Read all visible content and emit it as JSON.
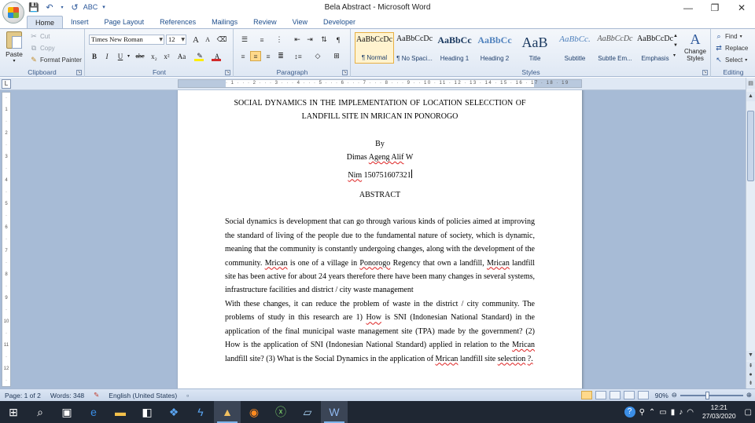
{
  "window": {
    "title": "Bela Abstract - Microsoft Word",
    "minimize": "—",
    "restore": "❐",
    "close": "✕"
  },
  "tabs": [
    "Home",
    "Insert",
    "Page Layout",
    "References",
    "Mailings",
    "Review",
    "View",
    "Developer"
  ],
  "ribbon": {
    "clipboard": {
      "label": "Clipboard",
      "paste": "Paste",
      "cut": "Cut",
      "copy": "Copy",
      "format_painter": "Format Painter"
    },
    "font": {
      "label": "Font",
      "font_name": "Times New Roman",
      "font_size": "12",
      "grow": "A",
      "shrink": "A",
      "bold": "B",
      "italic": "I",
      "underline": "U",
      "strike": "abc",
      "subscript": "x₂",
      "superscript": "x²",
      "change_case": "Aa",
      "highlight_color": "#ffee00",
      "font_color": "#d22a2a"
    },
    "paragraph": {
      "label": "Paragraph"
    },
    "styles": {
      "label": "Styles",
      "items": [
        {
          "preview": "AaBbCcDc",
          "name": "¶ Normal"
        },
        {
          "preview": "AaBbCcDc",
          "name": "¶ No Spaci..."
        },
        {
          "preview": "AaBbCc",
          "name": "Heading 1"
        },
        {
          "preview": "AaBbCc",
          "name": "Heading 2"
        },
        {
          "preview": "AaB",
          "name": "Title"
        },
        {
          "preview": "AaBbCc.",
          "name": "Subtitle"
        },
        {
          "preview": "AaBbCcDc",
          "name": "Subtle Em..."
        },
        {
          "preview": "AaBbCcDc",
          "name": "Emphasis"
        }
      ],
      "change_styles": "Change Styles"
    },
    "editing": {
      "label": "Editing",
      "find": "Find",
      "replace": "Replace",
      "select": "Select"
    }
  },
  "document": {
    "title_line1": "SOCIAL DYNAMICS IN THE IMPLEMENTATION OF LOCATION SELECCTION OF",
    "title_line2": "LANDFILL SITE IN MRICAN IN PONOROGO",
    "by": "By",
    "author_first": "Dimas",
    "author_spell": "Ageng Alif",
    "author_last": "W",
    "nim_label": "Nim",
    "nim_value": "150751607321",
    "abstract_heading": "ABSTRACT",
    "p1_a": "Social dynamics is development that can go through various kinds of policies aimed at improving the standard of living of the people due to the fundamental nature of society, which is dynamic, meaning that the community is constantly undergoing changes, along with the development of the community.",
    "p1_mrican1": "Mrican",
    "p1_b": "is one of a village in",
    "p1_ponorogo": "Ponorogo",
    "p1_c": "Regency that own a landfill,",
    "p1_mrican2": "Mrican",
    "p1_d": "landfill site has been active for about 24 years therefore there have been many changes in several systems, infrastructure facilities and district / city waste management",
    "p2_a": "With these changes, it can reduce the problem of waste in the district / city community. The problems of study in this research are 1)",
    "p2_how": "How",
    "p2_b": "is SNI (Indonesian National Standard) in the application of the final municipal waste management site (TPA) made by the government? (2) How is the application of SNI (Indonesian National Standard) applied in relation to the",
    "p2_mrican1": "Mrican",
    "p2_c": "landfill site? (3) What is the Social Dynamics in the application of",
    "p2_mrican2": "Mrican",
    "p2_d": "landfill site",
    "p2_selection": "selection",
    "p2_end": "?."
  },
  "statusbar": {
    "page": "Page: 1 of 2",
    "words": "Words: 348",
    "language": "English (United States)",
    "zoom": "90%",
    "zoom_level": 0.9
  },
  "taskbar": {
    "time": "12:21",
    "date": "27/03/2020"
  }
}
